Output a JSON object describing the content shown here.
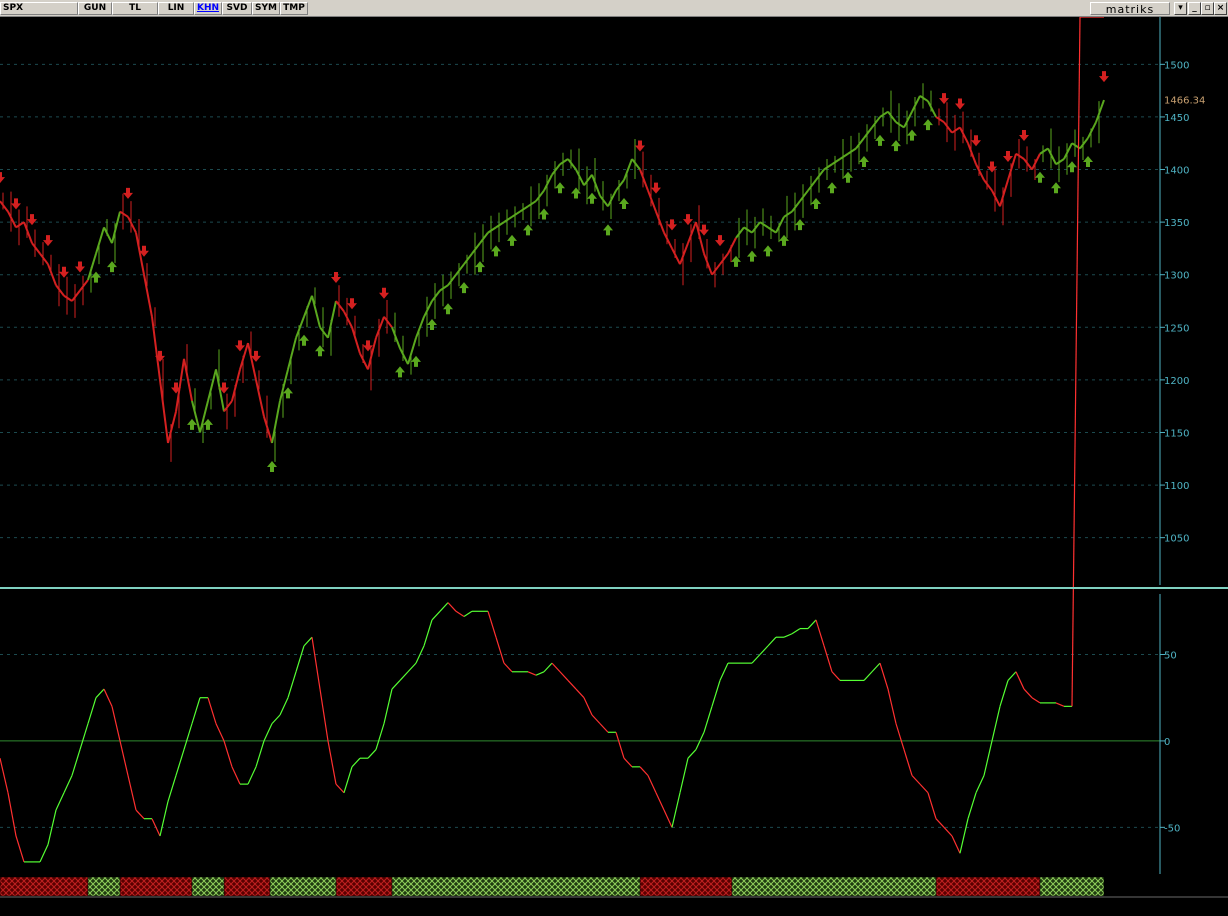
{
  "toolbar": {
    "symbol": "SPX",
    "buttons": [
      "GUN",
      "TL",
      "LIN",
      "KHN",
      "SVD",
      "SYM",
      "TMP"
    ],
    "active": "KHN",
    "brand": "matriks",
    "window_buttons": [
      "▾",
      "_",
      "▫",
      "×"
    ]
  },
  "colors": {
    "background": "#000000",
    "up": "#5aa81e",
    "down": "#d42020",
    "axis": "#4fb3c4",
    "grid": "#1c4a4f",
    "osc_up": "#55ff33",
    "osc_down": "#ff3030",
    "price_label": "#c8a070"
  },
  "chart_data": [
    {
      "type": "line",
      "name": "price-panel",
      "y_ticks": [
        1050,
        1100,
        1150,
        1200,
        1250,
        1300,
        1350,
        1400,
        1450,
        1500
      ],
      "ylim": [
        1005,
        1545
      ],
      "last_price": "1466.34",
      "x": [
        0,
        8,
        16,
        24,
        32,
        40,
        48,
        56,
        64,
        72,
        80,
        88,
        96,
        104,
        112,
        120,
        128,
        136,
        144,
        152,
        160,
        168,
        176,
        184,
        192,
        200,
        208,
        216,
        224,
        232,
        240,
        248,
        256,
        264,
        272,
        280,
        288,
        296,
        304,
        312,
        320,
        328,
        336,
        344,
        352,
        360,
        368,
        376,
        384,
        392,
        400,
        408,
        416,
        424,
        432,
        440,
        448,
        456,
        464,
        472,
        480,
        488,
        496,
        504,
        512,
        520,
        528,
        536,
        544,
        552,
        560,
        568,
        576,
        584,
        592,
        600,
        608,
        616,
        624,
        632,
        640,
        648,
        656,
        664,
        672,
        680,
        688,
        696,
        704,
        712,
        720,
        728,
        736,
        744,
        752,
        760,
        768,
        776,
        784,
        792,
        800,
        808,
        816,
        824,
        832,
        840,
        848,
        856,
        864,
        872,
        880,
        888,
        896,
        904,
        912,
        920,
        928,
        936,
        944,
        952,
        960,
        968,
        976,
        984,
        992,
        1000,
        1008,
        1016,
        1024,
        1032,
        1040,
        1048,
        1056,
        1064,
        1072,
        1080,
        1088,
        1096,
        1104
      ],
      "values": [
        1370,
        1360,
        1345,
        1350,
        1330,
        1320,
        1310,
        1290,
        1280,
        1275,
        1285,
        1295,
        1320,
        1345,
        1330,
        1360,
        1355,
        1340,
        1300,
        1260,
        1200,
        1140,
        1170,
        1220,
        1180,
        1150,
        1180,
        1210,
        1170,
        1180,
        1210,
        1235,
        1200,
        1165,
        1140,
        1180,
        1210,
        1240,
        1260,
        1280,
        1250,
        1240,
        1275,
        1265,
        1250,
        1225,
        1210,
        1240,
        1260,
        1250,
        1230,
        1215,
        1240,
        1260,
        1275,
        1285,
        1290,
        1300,
        1310,
        1320,
        1330,
        1340,
        1345,
        1350,
        1355,
        1360,
        1365,
        1370,
        1380,
        1395,
        1405,
        1410,
        1400,
        1385,
        1395,
        1375,
        1365,
        1380,
        1390,
        1410,
        1400,
        1380,
        1360,
        1340,
        1325,
        1310,
        1330,
        1350,
        1320,
        1300,
        1310,
        1320,
        1335,
        1345,
        1340,
        1350,
        1345,
        1340,
        1355,
        1360,
        1370,
        1380,
        1390,
        1400,
        1405,
        1410,
        1415,
        1420,
        1430,
        1440,
        1450,
        1455,
        1445,
        1440,
        1455,
        1470,
        1465,
        1450,
        1445,
        1435,
        1440,
        1425,
        1405,
        1390,
        1380,
        1365,
        1390,
        1415,
        1410,
        1400,
        1415,
        1420,
        1405,
        1410,
        1425,
        1420,
        1430,
        1445,
        1466
      ],
      "down_segments": [
        [
          0,
          88
        ],
        [
          120,
          192
        ],
        [
          224,
          270
        ],
        [
          336,
          392
        ],
        [
          640,
          732
        ],
        [
          936,
          1040
        ]
      ],
      "up_segments": [
        [
          88,
          120
        ],
        [
          192,
          224
        ],
        [
          270,
          336
        ],
        [
          392,
          640
        ],
        [
          732,
          936
        ],
        [
          1040,
          1104
        ]
      ]
    },
    {
      "type": "line",
      "name": "oscillator-panel",
      "y_ticks": [
        -50,
        0,
        50
      ],
      "ylim": [
        -77,
        85
      ],
      "x": [
        0,
        8,
        16,
        24,
        32,
        40,
        48,
        56,
        64,
        72,
        80,
        88,
        96,
        104,
        112,
        120,
        128,
        136,
        144,
        152,
        160,
        168,
        176,
        184,
        192,
        200,
        208,
        216,
        224,
        232,
        240,
        248,
        256,
        264,
        272,
        280,
        288,
        296,
        304,
        312,
        320,
        328,
        336,
        344,
        352,
        360,
        368,
        376,
        384,
        392,
        400,
        408,
        416,
        424,
        432,
        440,
        448,
        456,
        464,
        472,
        480,
        488,
        496,
        504,
        512,
        520,
        528,
        536,
        544,
        552,
        560,
        568,
        576,
        584,
        592,
        600,
        608,
        616,
        624,
        632,
        640,
        648,
        656,
        664,
        672,
        680,
        688,
        696,
        704,
        712,
        720,
        728,
        736,
        744,
        752,
        760,
        768,
        776,
        784,
        792,
        800,
        808,
        816,
        824,
        832,
        840,
        848,
        856,
        864,
        872,
        880,
        888,
        896,
        904,
        912,
        920,
        928,
        936,
        944,
        952,
        960,
        968,
        976,
        984,
        992,
        1000,
        1008,
        1016,
        1024,
        1032,
        1040,
        1048,
        1056,
        1064,
        1072,
        1080,
        1088,
        1096,
        1104
      ],
      "values": [
        -10,
        -30,
        -55,
        -70,
        -70,
        -70,
        -60,
        -40,
        -30,
        -20,
        -5,
        10,
        25,
        30,
        20,
        0,
        -20,
        -40,
        -45,
        -45,
        -55,
        -35,
        -20,
        -5,
        10,
        25,
        25,
        10,
        0,
        -15,
        -25,
        -25,
        -15,
        0,
        10,
        15,
        25,
        40,
        55,
        60,
        30,
        0,
        -25,
        -30,
        -15,
        -10,
        -10,
        -5,
        10,
        30,
        35,
        40,
        45,
        55,
        70,
        75,
        80,
        75,
        72,
        75,
        75,
        75,
        60,
        45,
        40,
        40,
        40,
        38,
        40,
        45,
        40,
        35,
        30,
        25,
        15,
        10,
        5,
        5,
        -10,
        -15,
        -15,
        -20,
        -30,
        -40,
        -50,
        -30,
        -10,
        -5,
        5,
        20,
        35,
        45,
        45,
        45,
        45,
        50,
        55,
        60,
        60,
        62,
        65,
        65,
        70,
        55,
        40,
        35,
        35,
        35,
        35,
        40,
        45,
        30,
        10,
        -5,
        -20,
        -25,
        -30,
        -45,
        -50,
        -55,
        -65,
        -45,
        -30,
        -20,
        0,
        20,
        35,
        40,
        30,
        25,
        22,
        22,
        22,
        20,
        20
      ]
    }
  ]
}
